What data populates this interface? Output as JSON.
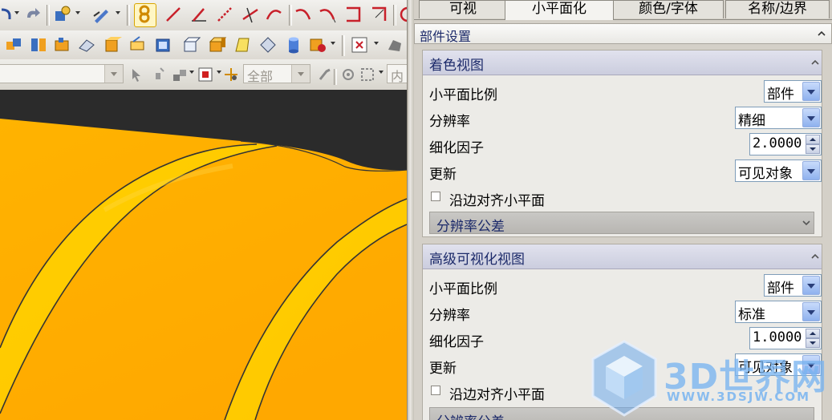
{
  "toolbar": {
    "combo_empty": "",
    "filter_combo": "全部",
    "trail_combo": "内"
  },
  "panel": {
    "tabs": [
      {
        "label": "可视",
        "active": false
      },
      {
        "label": "小平面化",
        "active": true
      },
      {
        "label": "颜色/字体",
        "active": false
      },
      {
        "label": "名称/边界",
        "active": false
      }
    ],
    "section_title": "部件设置",
    "shaded_view": {
      "title": "着色视图",
      "facet_ratio_label": "小平面比例",
      "facet_ratio_value": "部件",
      "resolution_label": "分辨率",
      "resolution_value": "精细",
      "refine_factor_label": "细化因子",
      "refine_factor_value": "2.0000",
      "update_label": "更新",
      "update_value": "可见对象",
      "align_checkbox_label": "沿边对齐小平面",
      "align_checked": false,
      "tolerance_group": "分辨率公差"
    },
    "advanced_view": {
      "title": "高级可视化视图",
      "facet_ratio_label": "小平面比例",
      "facet_ratio_value": "部件",
      "resolution_label": "分辨率",
      "resolution_value": "标准",
      "refine_factor_label": "细化因子",
      "refine_factor_value": "1.0000",
      "update_label": "更新",
      "update_value": "可见对象",
      "align_checkbox_label": "沿边对齐小平面",
      "align_checked": false,
      "tolerance_group": "分辨率公差"
    }
  },
  "watermark": {
    "main": "3D世界网",
    "sub": "WWW.3DSJW.COM"
  },
  "colors": {
    "model_orange": "#ffb000",
    "model_yellow": "#ffcc00",
    "viewport_bg": "#2b2b2b",
    "panel_bg": "#d4d0c8",
    "dropdown_button": "#8fb1ee"
  }
}
